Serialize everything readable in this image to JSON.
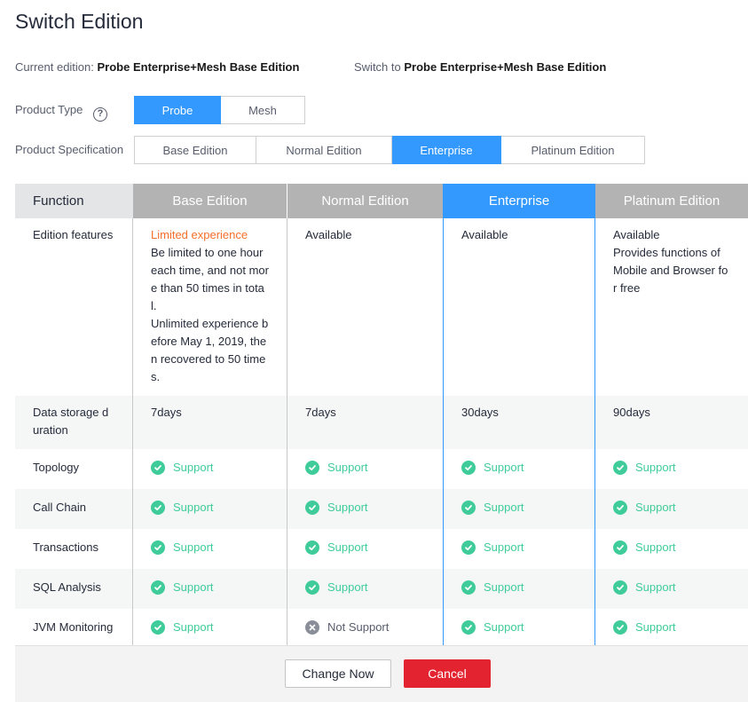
{
  "dialog": {
    "title": "Switch Edition"
  },
  "edition_info": {
    "current_label": "Current edition:",
    "current_value": "Probe Enterprise+Mesh Base Edition",
    "switch_label": "Switch to",
    "switch_value": "Probe Enterprise+Mesh Base Edition"
  },
  "product_type": {
    "label": "Product Type",
    "help_icon": "question-circle-icon",
    "help_glyph": "?",
    "options": [
      {
        "label": "Probe",
        "selected": true
      },
      {
        "label": "Mesh",
        "selected": false
      }
    ]
  },
  "product_spec": {
    "label": "Product Specification",
    "options": [
      {
        "label": "Base Edition",
        "selected": false
      },
      {
        "label": "Normal Edition",
        "selected": false
      },
      {
        "label": "Enterprise",
        "selected": true
      },
      {
        "label": "Platinum Edition",
        "selected": false
      }
    ]
  },
  "table": {
    "headers": [
      "Function",
      "Base Edition",
      "Normal Edition",
      "Enterprise",
      "Platinum Edition"
    ],
    "highlight_column": "Enterprise",
    "features_row": {
      "function": "Edition features",
      "base_warning": "Limited experience",
      "base_detail": "Be limited to one hour each time, and not more than 50 times in total.\nUnlimited experience before May 1, 2019, then recovered to 50 times.",
      "normal": "Available",
      "enterprise": "Available",
      "platinum": "Available\nProvides functions of Mobile and Browser for free"
    },
    "storage_row": {
      "function": "Data storage duration",
      "values": [
        "7days",
        "7days",
        "30days",
        "90days"
      ]
    },
    "feature_rows": [
      {
        "function": "Topology",
        "values": [
          "Support",
          "Support",
          "Support",
          "Support"
        ],
        "supported": [
          true,
          true,
          true,
          true
        ]
      },
      {
        "function": "Call Chain",
        "values": [
          "Support",
          "Support",
          "Support",
          "Support"
        ],
        "supported": [
          true,
          true,
          true,
          true
        ]
      },
      {
        "function": "Transactions",
        "values": [
          "Support",
          "Support",
          "Support",
          "Support"
        ],
        "supported": [
          true,
          true,
          true,
          true
        ]
      },
      {
        "function": "SQL Analysis",
        "values": [
          "Support",
          "Support",
          "Support",
          "Support"
        ],
        "supported": [
          true,
          true,
          true,
          true
        ]
      },
      {
        "function": "JVM Monitoring",
        "values": [
          "Support",
          "Not Support",
          "Support",
          "Support"
        ],
        "supported": [
          true,
          false,
          true,
          true
        ]
      }
    ]
  },
  "footer": {
    "change_now_label": "Change Now",
    "cancel_label": "Cancel"
  },
  "colors": {
    "accent": "#3399ff",
    "success": "#3fcc9a",
    "warning": "#f66f2a",
    "danger": "#e32330",
    "muted_icon": "#8a8e99"
  }
}
